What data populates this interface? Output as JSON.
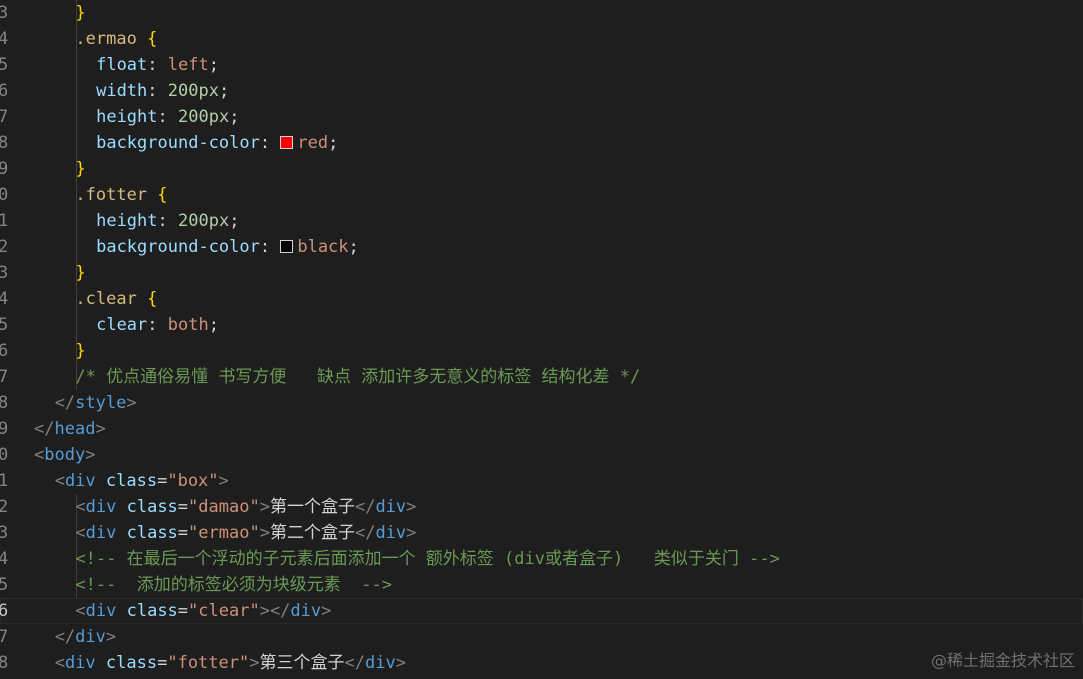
{
  "editor": {
    "lines": [
      {
        "no": "3",
        "indent": 4,
        "tokens": [
          {
            "t": "}",
            "c": "brace"
          }
        ]
      },
      {
        "no": "4",
        "indent": 4,
        "tokens": [
          {
            "t": ".ermao",
            "c": "sel"
          },
          {
            "t": " "
          },
          {
            "t": "{",
            "c": "brace"
          }
        ]
      },
      {
        "no": "5",
        "indent": 6,
        "tokens": [
          {
            "t": "float",
            "c": "prop"
          },
          {
            "t": ": "
          },
          {
            "t": "left",
            "c": "val"
          },
          {
            "t": ";"
          }
        ]
      },
      {
        "no": "6",
        "indent": 6,
        "tokens": [
          {
            "t": "width",
            "c": "prop"
          },
          {
            "t": ": "
          },
          {
            "t": "200px",
            "c": "num"
          },
          {
            "t": ";"
          }
        ]
      },
      {
        "no": "7",
        "indent": 6,
        "tokens": [
          {
            "t": "height",
            "c": "prop"
          },
          {
            "t": ": "
          },
          {
            "t": "200px",
            "c": "num"
          },
          {
            "t": ";"
          }
        ]
      },
      {
        "no": "8",
        "indent": 6,
        "tokens": [
          {
            "t": "background-color",
            "c": "prop"
          },
          {
            "t": ": "
          },
          {
            "swatch": "#ff0000"
          },
          {
            "t": "red",
            "c": "val"
          },
          {
            "t": ";"
          }
        ]
      },
      {
        "no": "9",
        "indent": 4,
        "tokens": [
          {
            "t": "}",
            "c": "brace"
          }
        ]
      },
      {
        "no": "0",
        "indent": 4,
        "tokens": [
          {
            "t": ".fotter",
            "c": "sel"
          },
          {
            "t": " "
          },
          {
            "t": "{",
            "c": "brace"
          }
        ]
      },
      {
        "no": "1",
        "indent": 6,
        "tokens": [
          {
            "t": "height",
            "c": "prop"
          },
          {
            "t": ": "
          },
          {
            "t": "200px",
            "c": "num"
          },
          {
            "t": ";"
          }
        ]
      },
      {
        "no": "2",
        "indent": 6,
        "tokens": [
          {
            "t": "background-color",
            "c": "prop"
          },
          {
            "t": ": "
          },
          {
            "swatch": "#000000"
          },
          {
            "t": "black",
            "c": "val"
          },
          {
            "t": ";"
          }
        ]
      },
      {
        "no": "3",
        "indent": 4,
        "tokens": [
          {
            "t": "}",
            "c": "brace"
          }
        ]
      },
      {
        "no": "4",
        "indent": 4,
        "tokens": [
          {
            "t": ".clear",
            "c": "sel"
          },
          {
            "t": " "
          },
          {
            "t": "{",
            "c": "brace"
          }
        ]
      },
      {
        "no": "5",
        "indent": 6,
        "tokens": [
          {
            "t": "clear",
            "c": "prop"
          },
          {
            "t": ": "
          },
          {
            "t": "both",
            "c": "val"
          },
          {
            "t": ";"
          }
        ]
      },
      {
        "no": "6",
        "indent": 4,
        "tokens": [
          {
            "t": "}",
            "c": "brace"
          }
        ]
      },
      {
        "no": "7",
        "indent": 4,
        "tokens": [
          {
            "t": "/* 优点通俗易懂 书写方便   缺点 添加许多无意义的标签 结构化差 */",
            "c": "comment"
          }
        ]
      },
      {
        "no": "8",
        "indent": 2,
        "tokens": [
          {
            "t": "</",
            "c": "angle"
          },
          {
            "t": "style",
            "c": "tag"
          },
          {
            "t": ">",
            "c": "angle"
          }
        ]
      },
      {
        "no": "9",
        "indent": 0,
        "tokens": [
          {
            "t": "</",
            "c": "angle"
          },
          {
            "t": "head",
            "c": "tag"
          },
          {
            "t": ">",
            "c": "angle"
          }
        ]
      },
      {
        "no": "0",
        "indent": 0,
        "tokens": [
          {
            "t": "<",
            "c": "angle"
          },
          {
            "t": "body",
            "c": "tag"
          },
          {
            "t": ">",
            "c": "angle"
          }
        ]
      },
      {
        "no": "1",
        "indent": 2,
        "tokens": [
          {
            "t": "<",
            "c": "angle"
          },
          {
            "t": "div",
            "c": "tag"
          },
          {
            "t": " "
          },
          {
            "t": "class",
            "c": "attr"
          },
          {
            "t": "="
          },
          {
            "t": "\"box\"",
            "c": "str"
          },
          {
            "t": ">",
            "c": "angle"
          }
        ]
      },
      {
        "no": "2",
        "indent": 4,
        "tokens": [
          {
            "t": "<",
            "c": "angle"
          },
          {
            "t": "div",
            "c": "tag"
          },
          {
            "t": " "
          },
          {
            "t": "class",
            "c": "attr"
          },
          {
            "t": "="
          },
          {
            "t": "\"damao\"",
            "c": "str"
          },
          {
            "t": ">",
            "c": "angle"
          },
          {
            "t": "第一个盒子",
            "c": "txt"
          },
          {
            "t": "</",
            "c": "angle"
          },
          {
            "t": "div",
            "c": "tag"
          },
          {
            "t": ">",
            "c": "angle"
          }
        ]
      },
      {
        "no": "3",
        "indent": 4,
        "tokens": [
          {
            "t": "<",
            "c": "angle"
          },
          {
            "t": "div",
            "c": "tag"
          },
          {
            "t": " "
          },
          {
            "t": "class",
            "c": "attr"
          },
          {
            "t": "="
          },
          {
            "t": "\"ermao\"",
            "c": "str"
          },
          {
            "t": ">",
            "c": "angle"
          },
          {
            "t": "第二个盒子",
            "c": "txt"
          },
          {
            "t": "</",
            "c": "angle"
          },
          {
            "t": "div",
            "c": "tag"
          },
          {
            "t": ">",
            "c": "angle"
          }
        ]
      },
      {
        "no": "4",
        "indent": 4,
        "tokens": [
          {
            "t": "<!-- 在最后一个浮动的子元素后面添加一个 额外标签 (div或者盒子)   类似于关门 -->",
            "c": "comment"
          }
        ]
      },
      {
        "no": "5",
        "indent": 4,
        "tokens": [
          {
            "t": "<!--  添加的标签必须为块级元素  -->",
            "c": "comment"
          }
        ]
      },
      {
        "no": "6",
        "indent": 4,
        "current": true,
        "tokens": [
          {
            "t": "<",
            "c": "angle"
          },
          {
            "t": "div",
            "c": "tag"
          },
          {
            "t": " "
          },
          {
            "t": "class",
            "c": "attr"
          },
          {
            "t": "="
          },
          {
            "t": "\"clear\"",
            "c": "str"
          },
          {
            "t": "></",
            "c": "angle"
          },
          {
            "t": "div",
            "c": "tag"
          },
          {
            "t": ">",
            "c": "angle"
          }
        ]
      },
      {
        "no": "7",
        "indent": 2,
        "tokens": [
          {
            "t": "</",
            "c": "angle"
          },
          {
            "t": "div",
            "c": "tag"
          },
          {
            "t": ">",
            "c": "angle"
          }
        ]
      },
      {
        "no": "8",
        "indent": 2,
        "tokens": [
          {
            "t": "<",
            "c": "angle"
          },
          {
            "t": "div",
            "c": "tag"
          },
          {
            "t": " "
          },
          {
            "t": "class",
            "c": "attr"
          },
          {
            "t": "="
          },
          {
            "t": "\"fotter\"",
            "c": "str"
          },
          {
            "t": ">",
            "c": "angle"
          },
          {
            "t": "第三个盒子",
            "c": "txt"
          },
          {
            "t": "</",
            "c": "angle"
          },
          {
            "t": "div",
            "c": "tag"
          },
          {
            "t": ">",
            "c": "angle"
          }
        ]
      }
    ]
  },
  "watermark": "@稀土掘金技术社区"
}
